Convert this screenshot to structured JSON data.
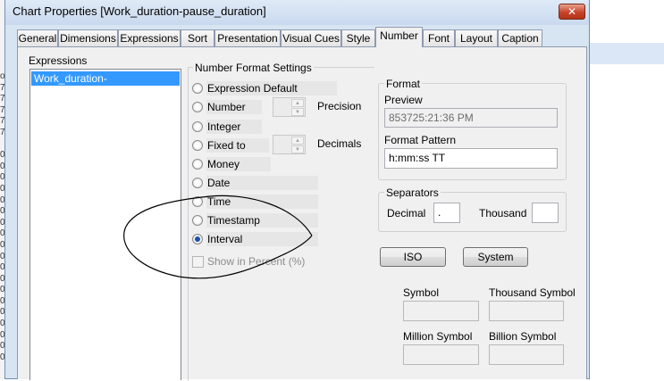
{
  "window": {
    "title": "Chart Properties [Work_duration-pause_duration]",
    "close_glyph": "✕"
  },
  "tabs": [
    {
      "label": "General",
      "active": false
    },
    {
      "label": "Dimensions",
      "active": false
    },
    {
      "label": "Expressions",
      "active": false
    },
    {
      "label": "Sort",
      "active": false
    },
    {
      "label": "Presentation",
      "active": false
    },
    {
      "label": "Visual Cues",
      "active": false
    },
    {
      "label": "Style",
      "active": false
    },
    {
      "label": "Number",
      "active": true
    },
    {
      "label": "Font",
      "active": false
    },
    {
      "label": "Layout",
      "active": false
    },
    {
      "label": "Caption",
      "active": false
    }
  ],
  "expressions": {
    "label": "Expressions",
    "items": [
      "Work_duration-pause_duration"
    ],
    "selected_index": 0
  },
  "number_format": {
    "group_label": "Number Format Settings",
    "options": [
      {
        "label": "Expression Default",
        "checked": false
      },
      {
        "label": "Number",
        "checked": false
      },
      {
        "label": "Integer",
        "checked": false
      },
      {
        "label": "Fixed to",
        "checked": false
      },
      {
        "label": "Money",
        "checked": false
      },
      {
        "label": "Date",
        "checked": false
      },
      {
        "label": "Time",
        "checked": false
      },
      {
        "label": "Timestamp",
        "checked": false
      },
      {
        "label": "Interval",
        "checked": true
      }
    ],
    "precision_label": "Precision",
    "decimals_label": "Decimals",
    "show_in_percent_label": "Show in Percent (%)",
    "show_in_percent_checked": false
  },
  "format": {
    "group_label": "Format",
    "preview_label": "Preview",
    "preview_value": "853725:21:36 PM",
    "pattern_label": "Format Pattern",
    "pattern_value": "h:mm:ss TT"
  },
  "separators": {
    "group_label": "Separators",
    "decimal_label": "Decimal",
    "decimal_value": ".",
    "thousand_label": "Thousand",
    "thousand_value": ""
  },
  "buttons": {
    "iso": "ISO",
    "system": "System"
  },
  "symbols": {
    "symbol_label": "Symbol",
    "thousand_symbol_label": "Thousand Symbol",
    "million_symbol_label": "Million Symbol",
    "billion_symbol_label": "Billion Symbol"
  },
  "background_left_column": [
    "o",
    "7",
    "7",
    "7",
    "7",
    "7",
    "",
    "0",
    "0",
    "0",
    "0",
    "0",
    "0",
    "0",
    "0",
    "0",
    "0",
    "0",
    "0",
    "0",
    "0",
    "0",
    "0",
    "0",
    "0",
    "0"
  ],
  "annotation_color": "#000000"
}
